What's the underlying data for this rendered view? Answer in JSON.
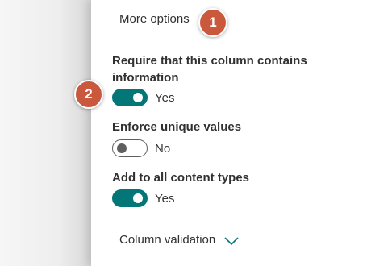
{
  "panel": {
    "more_options_label": "More options",
    "column_validation_label": "Column validation",
    "column_validation_icon": "chevron-down-icon"
  },
  "settings": [
    {
      "label": "Require that this column contains information",
      "state": "Yes",
      "on": true
    },
    {
      "label": "Enforce unique values",
      "state": "No",
      "on": false
    },
    {
      "label": "Add to all content types",
      "state": "Yes",
      "on": true
    }
  ],
  "callouts": [
    {
      "number": "1"
    },
    {
      "number": "2"
    }
  ],
  "colors": {
    "toggle_on": "#037777",
    "toggle_off_border": "#5f5f5f",
    "callout_badge": "#c9583d",
    "chevron": "#037777"
  }
}
